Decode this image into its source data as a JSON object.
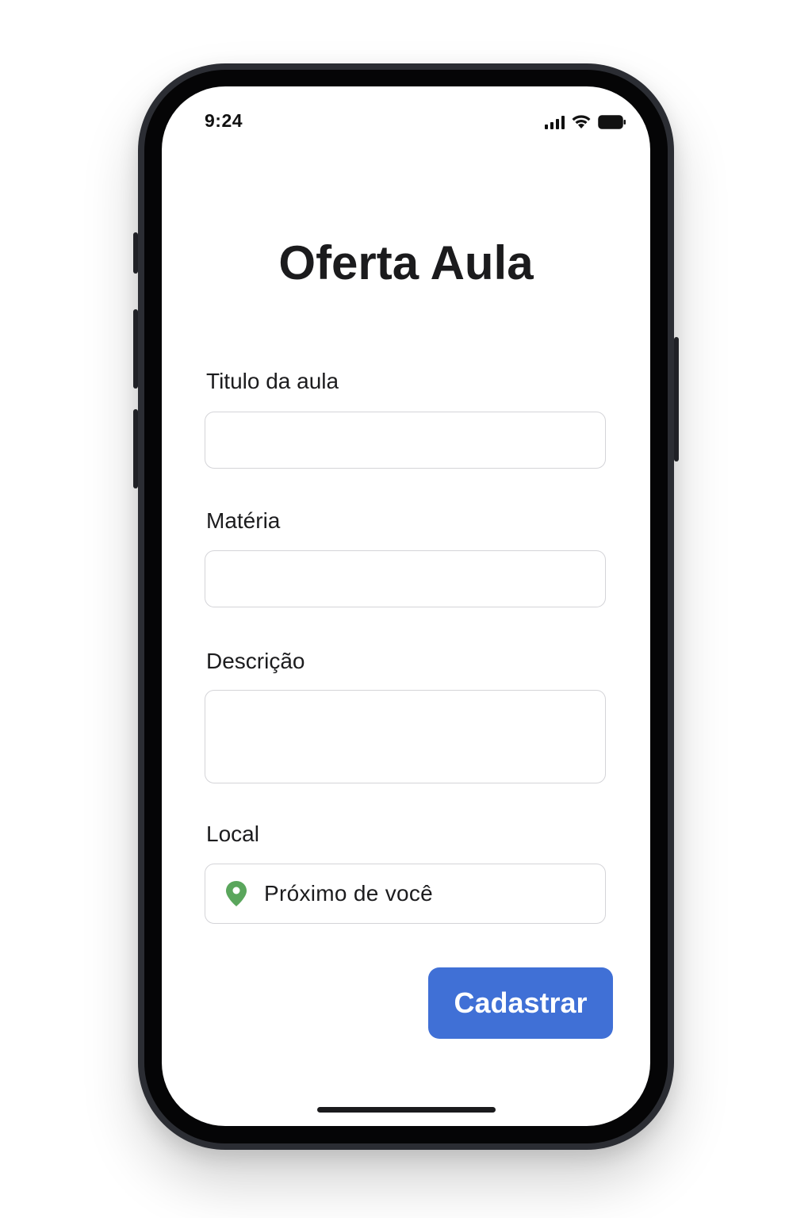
{
  "status_bar": {
    "time": "9:24",
    "icons": [
      "cellular-signal-icon",
      "wifi-icon",
      "battery-icon"
    ]
  },
  "form": {
    "title": "Oferta Aula",
    "fields": {
      "titulo": {
        "label": "Titulo da aula",
        "value": "",
        "placeholder": ""
      },
      "materia": {
        "label": "Matéria",
        "value": "",
        "placeholder": ""
      },
      "descricao": {
        "label": "Descrição",
        "value": "",
        "placeholder": ""
      },
      "local": {
        "label": "Local",
        "value": "Próximo de você",
        "icon": "location-pin-icon"
      }
    },
    "submit_label": "Cadastrar"
  },
  "colors": {
    "primary_button": "#4070d6",
    "pin_green": "#5aa65c",
    "text": "#1c1c1e",
    "input_border": "#d4d4d8"
  }
}
